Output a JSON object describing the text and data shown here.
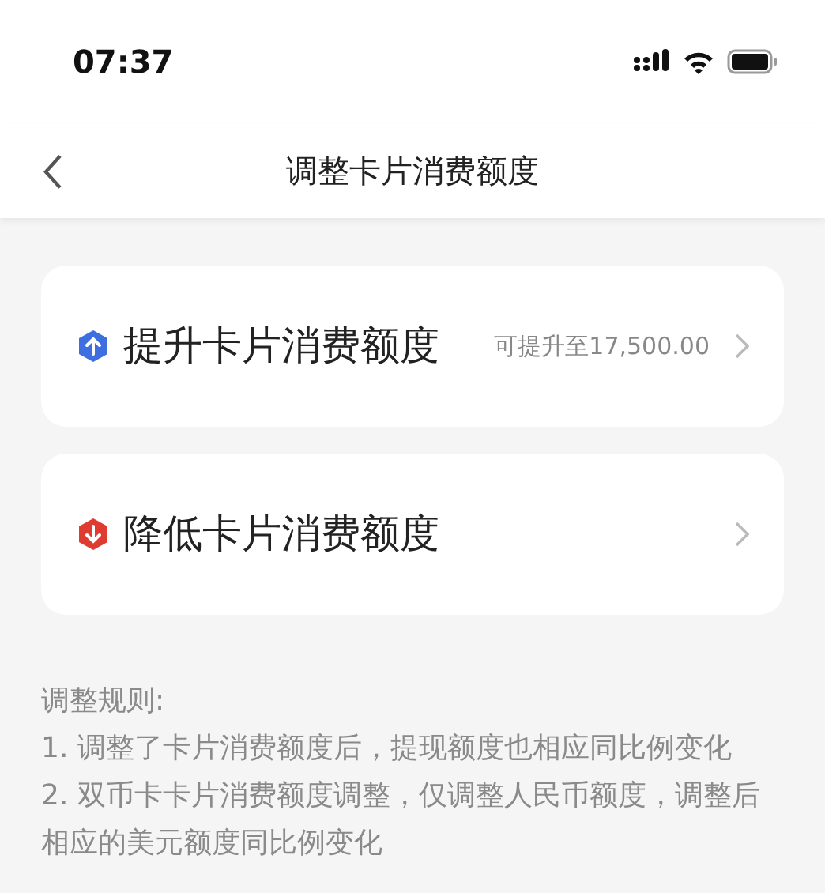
{
  "status_bar": {
    "time": "07:37"
  },
  "header": {
    "title": "调整卡片消费额度"
  },
  "options": [
    {
      "kind": "raise",
      "label": "提升卡片消费额度",
      "note": "可提升至17,500.00"
    },
    {
      "kind": "lower",
      "label": "降低卡片消费额度"
    }
  ],
  "rules": {
    "title": "调整规则:",
    "items": [
      "1. 调整了卡片消费额度后，提现额度也相应同比例变化",
      "2. 双币卡卡片消费额度调整，仅调整人民币额度，调整后相应的美元额度同比例变化"
    ]
  }
}
